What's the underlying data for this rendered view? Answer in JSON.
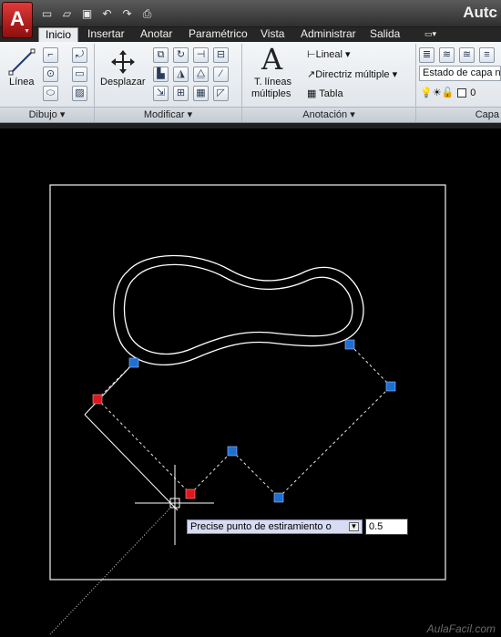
{
  "titlebar": {
    "title": "Autc",
    "app_button_glyph": "A"
  },
  "quick_access": [
    "new-icon",
    "open-icon",
    "save-icon",
    "undo-icon",
    "redo-icon",
    "print-icon"
  ],
  "tabs": [
    "Inicio",
    "Insertar",
    "Anotar",
    "Paramétrico",
    "Vista",
    "Administrar",
    "Salida"
  ],
  "ribbon": {
    "dibujo": {
      "title": "Dibujo",
      "linea_label": "Línea"
    },
    "modificar": {
      "title": "Modificar",
      "desplazar_label": "Desplazar"
    },
    "anotacion": {
      "title": "Anotación",
      "tlineas_label_1": "T. líneas",
      "tlineas_label_2": "múltiples",
      "lineal_label": "Lineal",
      "directriz_label": "Directriz múltiple",
      "tabla_label": "Tabla"
    },
    "capas": {
      "title": "Capa",
      "combo_value": "Estado de capa n",
      "layer_value": "0"
    }
  },
  "command": {
    "prompt": "Precise punto de estiramiento o",
    "input_value": "0.5"
  },
  "watermark": "AulaFacil.com",
  "colors": {
    "canvas": "#000000",
    "grip_selected": "#e0161b",
    "grip_unselected": "#1f6fd1",
    "geometry": "#ffffff"
  }
}
